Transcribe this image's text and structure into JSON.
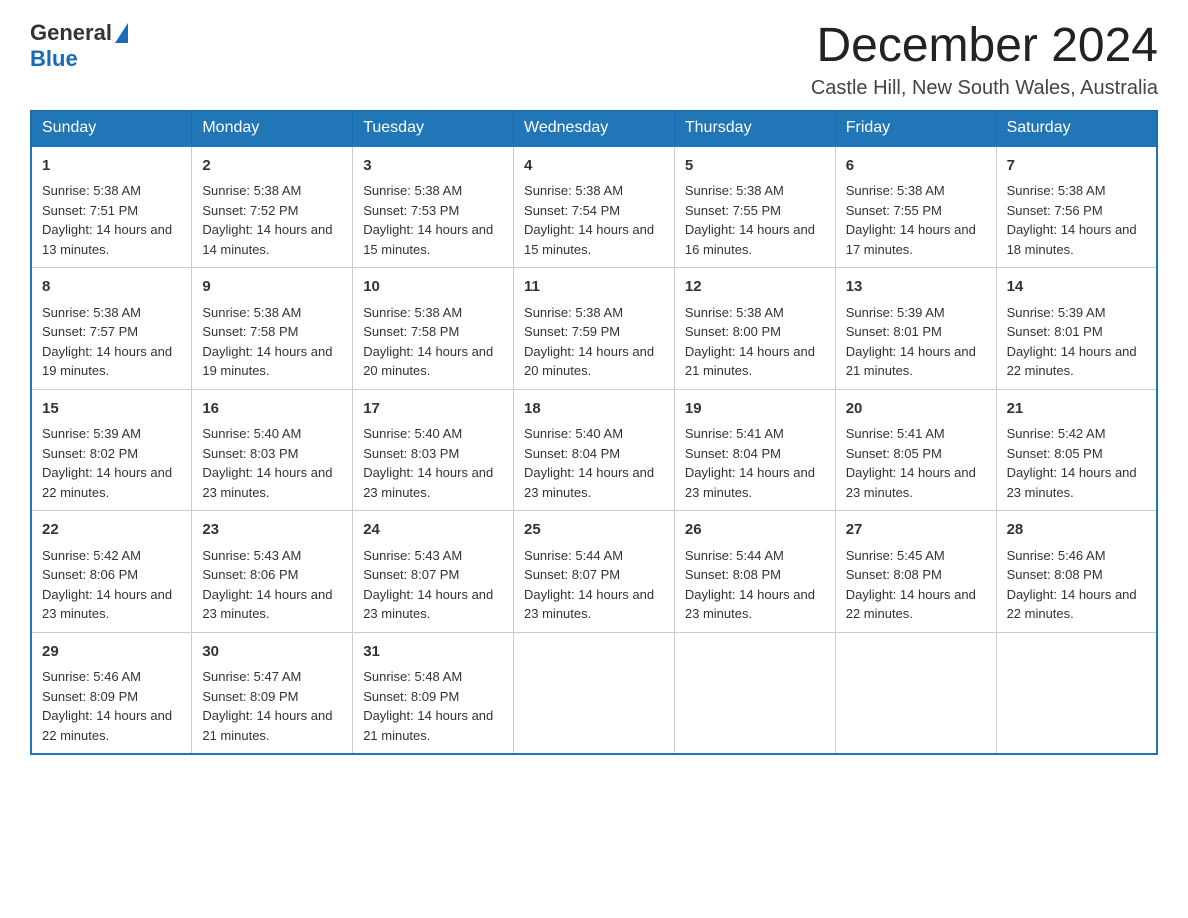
{
  "header": {
    "logo": {
      "text_general": "General",
      "text_blue": "Blue"
    },
    "title": "December 2024",
    "location": "Castle Hill, New South Wales, Australia"
  },
  "calendar": {
    "days_of_week": [
      "Sunday",
      "Monday",
      "Tuesday",
      "Wednesday",
      "Thursday",
      "Friday",
      "Saturday"
    ],
    "weeks": [
      [
        {
          "day": "1",
          "sunrise": "Sunrise: 5:38 AM",
          "sunset": "Sunset: 7:51 PM",
          "daylight": "Daylight: 14 hours and 13 minutes."
        },
        {
          "day": "2",
          "sunrise": "Sunrise: 5:38 AM",
          "sunset": "Sunset: 7:52 PM",
          "daylight": "Daylight: 14 hours and 14 minutes."
        },
        {
          "day": "3",
          "sunrise": "Sunrise: 5:38 AM",
          "sunset": "Sunset: 7:53 PM",
          "daylight": "Daylight: 14 hours and 15 minutes."
        },
        {
          "day": "4",
          "sunrise": "Sunrise: 5:38 AM",
          "sunset": "Sunset: 7:54 PM",
          "daylight": "Daylight: 14 hours and 15 minutes."
        },
        {
          "day": "5",
          "sunrise": "Sunrise: 5:38 AM",
          "sunset": "Sunset: 7:55 PM",
          "daylight": "Daylight: 14 hours and 16 minutes."
        },
        {
          "day": "6",
          "sunrise": "Sunrise: 5:38 AM",
          "sunset": "Sunset: 7:55 PM",
          "daylight": "Daylight: 14 hours and 17 minutes."
        },
        {
          "day": "7",
          "sunrise": "Sunrise: 5:38 AM",
          "sunset": "Sunset: 7:56 PM",
          "daylight": "Daylight: 14 hours and 18 minutes."
        }
      ],
      [
        {
          "day": "8",
          "sunrise": "Sunrise: 5:38 AM",
          "sunset": "Sunset: 7:57 PM",
          "daylight": "Daylight: 14 hours and 19 minutes."
        },
        {
          "day": "9",
          "sunrise": "Sunrise: 5:38 AM",
          "sunset": "Sunset: 7:58 PM",
          "daylight": "Daylight: 14 hours and 19 minutes."
        },
        {
          "day": "10",
          "sunrise": "Sunrise: 5:38 AM",
          "sunset": "Sunset: 7:58 PM",
          "daylight": "Daylight: 14 hours and 20 minutes."
        },
        {
          "day": "11",
          "sunrise": "Sunrise: 5:38 AM",
          "sunset": "Sunset: 7:59 PM",
          "daylight": "Daylight: 14 hours and 20 minutes."
        },
        {
          "day": "12",
          "sunrise": "Sunrise: 5:38 AM",
          "sunset": "Sunset: 8:00 PM",
          "daylight": "Daylight: 14 hours and 21 minutes."
        },
        {
          "day": "13",
          "sunrise": "Sunrise: 5:39 AM",
          "sunset": "Sunset: 8:01 PM",
          "daylight": "Daylight: 14 hours and 21 minutes."
        },
        {
          "day": "14",
          "sunrise": "Sunrise: 5:39 AM",
          "sunset": "Sunset: 8:01 PM",
          "daylight": "Daylight: 14 hours and 22 minutes."
        }
      ],
      [
        {
          "day": "15",
          "sunrise": "Sunrise: 5:39 AM",
          "sunset": "Sunset: 8:02 PM",
          "daylight": "Daylight: 14 hours and 22 minutes."
        },
        {
          "day": "16",
          "sunrise": "Sunrise: 5:40 AM",
          "sunset": "Sunset: 8:03 PM",
          "daylight": "Daylight: 14 hours and 23 minutes."
        },
        {
          "day": "17",
          "sunrise": "Sunrise: 5:40 AM",
          "sunset": "Sunset: 8:03 PM",
          "daylight": "Daylight: 14 hours and 23 minutes."
        },
        {
          "day": "18",
          "sunrise": "Sunrise: 5:40 AM",
          "sunset": "Sunset: 8:04 PM",
          "daylight": "Daylight: 14 hours and 23 minutes."
        },
        {
          "day": "19",
          "sunrise": "Sunrise: 5:41 AM",
          "sunset": "Sunset: 8:04 PM",
          "daylight": "Daylight: 14 hours and 23 minutes."
        },
        {
          "day": "20",
          "sunrise": "Sunrise: 5:41 AM",
          "sunset": "Sunset: 8:05 PM",
          "daylight": "Daylight: 14 hours and 23 minutes."
        },
        {
          "day": "21",
          "sunrise": "Sunrise: 5:42 AM",
          "sunset": "Sunset: 8:05 PM",
          "daylight": "Daylight: 14 hours and 23 minutes."
        }
      ],
      [
        {
          "day": "22",
          "sunrise": "Sunrise: 5:42 AM",
          "sunset": "Sunset: 8:06 PM",
          "daylight": "Daylight: 14 hours and 23 minutes."
        },
        {
          "day": "23",
          "sunrise": "Sunrise: 5:43 AM",
          "sunset": "Sunset: 8:06 PM",
          "daylight": "Daylight: 14 hours and 23 minutes."
        },
        {
          "day": "24",
          "sunrise": "Sunrise: 5:43 AM",
          "sunset": "Sunset: 8:07 PM",
          "daylight": "Daylight: 14 hours and 23 minutes."
        },
        {
          "day": "25",
          "sunrise": "Sunrise: 5:44 AM",
          "sunset": "Sunset: 8:07 PM",
          "daylight": "Daylight: 14 hours and 23 minutes."
        },
        {
          "day": "26",
          "sunrise": "Sunrise: 5:44 AM",
          "sunset": "Sunset: 8:08 PM",
          "daylight": "Daylight: 14 hours and 23 minutes."
        },
        {
          "day": "27",
          "sunrise": "Sunrise: 5:45 AM",
          "sunset": "Sunset: 8:08 PM",
          "daylight": "Daylight: 14 hours and 22 minutes."
        },
        {
          "day": "28",
          "sunrise": "Sunrise: 5:46 AM",
          "sunset": "Sunset: 8:08 PM",
          "daylight": "Daylight: 14 hours and 22 minutes."
        }
      ],
      [
        {
          "day": "29",
          "sunrise": "Sunrise: 5:46 AM",
          "sunset": "Sunset: 8:09 PM",
          "daylight": "Daylight: 14 hours and 22 minutes."
        },
        {
          "day": "30",
          "sunrise": "Sunrise: 5:47 AM",
          "sunset": "Sunset: 8:09 PM",
          "daylight": "Daylight: 14 hours and 21 minutes."
        },
        {
          "day": "31",
          "sunrise": "Sunrise: 5:48 AM",
          "sunset": "Sunset: 8:09 PM",
          "daylight": "Daylight: 14 hours and 21 minutes."
        },
        null,
        null,
        null,
        null
      ]
    ]
  }
}
